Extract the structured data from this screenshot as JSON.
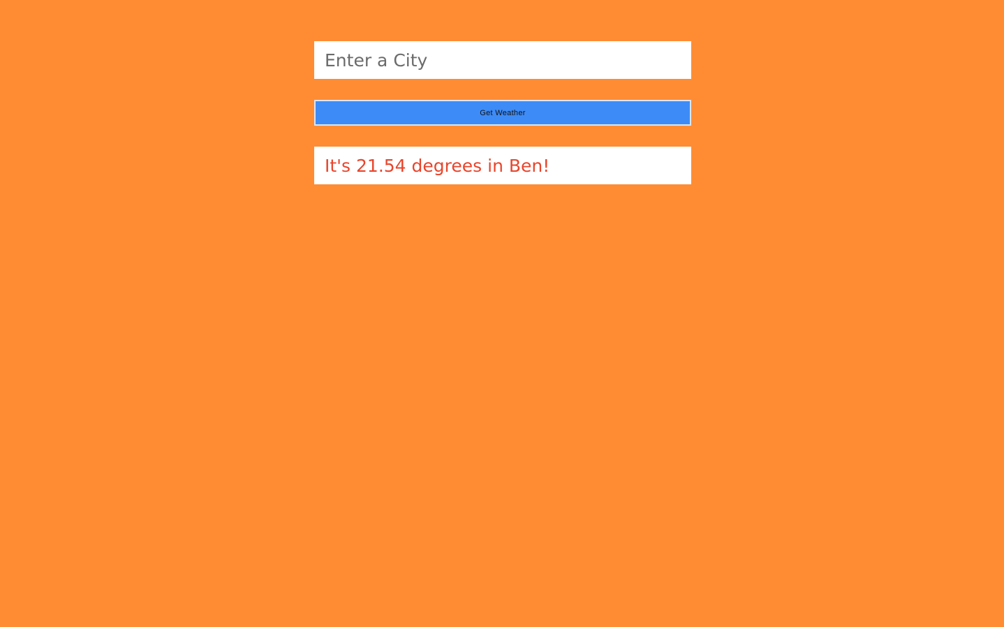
{
  "search": {
    "placeholder": "Enter a City",
    "value": ""
  },
  "button": {
    "label": "Get Weather"
  },
  "result": {
    "text": "It's 21.54 degrees in Ben!"
  },
  "colors": {
    "background": "#ff8c33",
    "button": "#3d8bf7",
    "result_text": "#e8452c"
  }
}
